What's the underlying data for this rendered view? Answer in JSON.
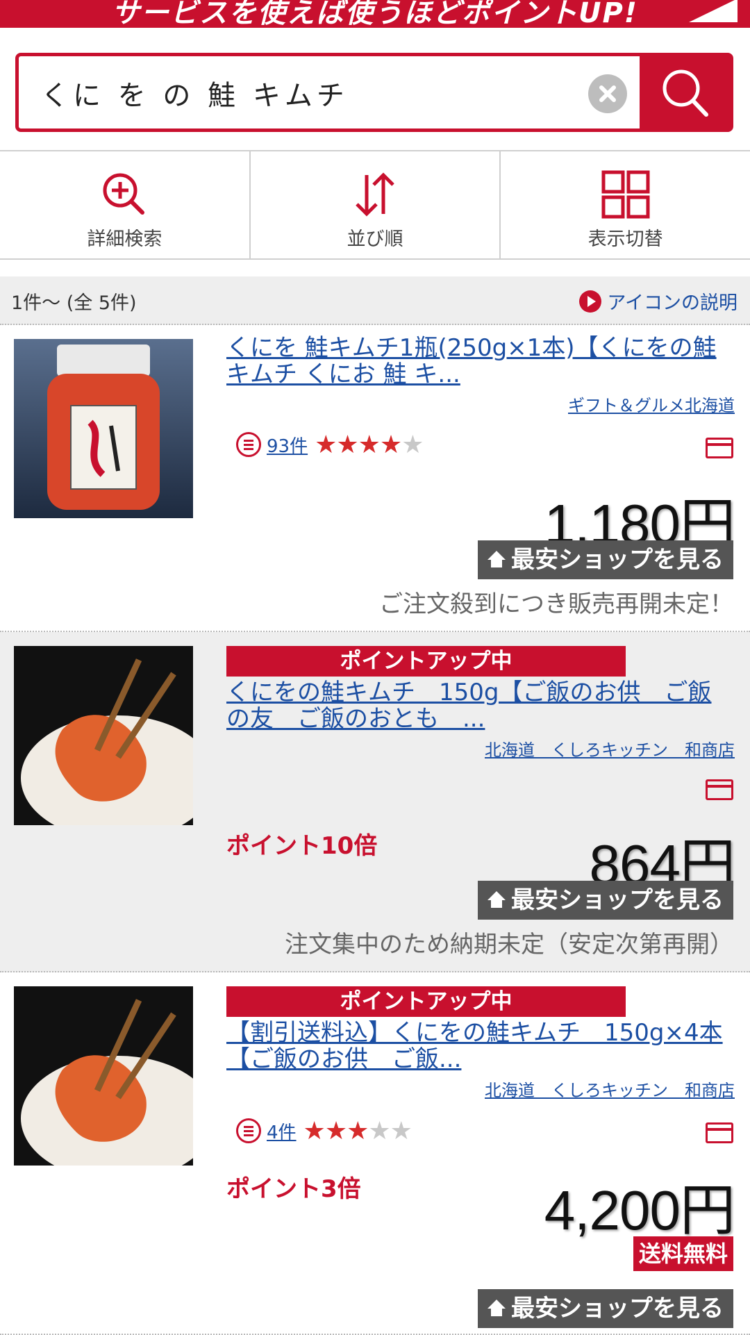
{
  "banner": {
    "text": "サービスを使えば使うほどポイントUP!"
  },
  "search": {
    "query": "くにをの鮭キムチ",
    "display_query": "くに を の 鮭 キムチ"
  },
  "toolbar": {
    "detail_search": "詳細検索",
    "sort": "並び順",
    "view_toggle": "表示切替"
  },
  "results": {
    "count_text": "1件〜 (全 5件)",
    "icon_help": "アイコンの説明"
  },
  "items": [
    {
      "title": "くにを 鮭キムチ1瓶(250g×1本)【くにをの鮭キムチ くにお 鮭 キ...",
      "shop": "ギフト＆グルメ北海道",
      "review_count": "93件",
      "rating": 4,
      "price": "1,180円",
      "cheapest_label": "最安ショップを見る",
      "note": "ご注文殺到につき販売再開未定！"
    },
    {
      "promo": "ポイントアップ中",
      "title": "くにをの鮭キムチ　150g【ご飯のお供　ご飯の友　ご飯のおとも　...",
      "shop": "北海道　くしろキッチン　和商店",
      "points": "ポイント10倍",
      "price": "864円",
      "cheapest_label": "最安ショップを見る",
      "note": "注文集中のため納期未定（安定次第再開）"
    },
    {
      "promo": "ポイントアップ中",
      "title": "【割引送料込】くにをの鮭キムチ　150g×4本【ご飯のお供　ご飯...",
      "shop": "北海道　くしろキッチン　和商店",
      "review_count": "4件",
      "rating": 3,
      "points": "ポイント3倍",
      "price": "4,200円",
      "free_shipping": "送料無料",
      "cheapest_label": "最安ショップを見る"
    }
  ],
  "colors": {
    "brand_red": "#c8102e",
    "link_blue": "#1c4fa3",
    "star_red": "#d62b2b"
  }
}
